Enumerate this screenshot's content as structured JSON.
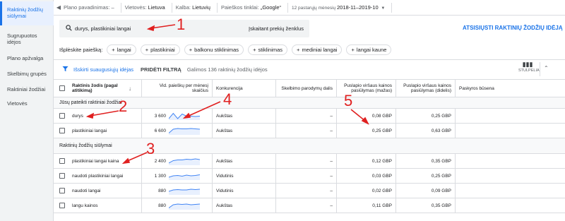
{
  "sidebar": {
    "items": [
      {
        "label": "Raktinių žodžių siūlymai",
        "active": true
      },
      {
        "label": "Sugrupuotos idėjos"
      },
      {
        "label": "Plano apžvalga"
      },
      {
        "label": "Skelbimų grupės"
      },
      {
        "label": "Raktiniai žodžiai"
      },
      {
        "label": "Vietovės"
      }
    ]
  },
  "topbar": {
    "plan_name": "Plano pavadinimas: –",
    "location_label": "Vietovės:",
    "location_value": "Lietuva",
    "language_label": "Kalba:",
    "language_value": "Lietuvių",
    "network_label": "Paieškos tinklai:",
    "network_value": "„Google“",
    "period_label": "12 pastarųjų mėnesių",
    "period_value": "2018-11–2019-10"
  },
  "search": {
    "value": "durys, plastikiniai langai",
    "include_label": "Įskaitant prekių ženklus"
  },
  "download_label": "ATSISIŲSTI RAKTINIŲ ŽODŽIŲ IDĖJĄ",
  "expand": {
    "label": "Išplėskite paiešką:",
    "chips": [
      "langai",
      "plastikiniai",
      "balkonu stiklinimas",
      "stiklinimas",
      "mediniai langai",
      "langai kaune"
    ]
  },
  "filters": {
    "exclude_label": "Išskirti suaugusiųjų idėjas",
    "add_filter": "PRIDĖTI FILTRĄ",
    "count_text": "Galimos 136 raktinių žodžių idėjos",
    "columns_label": "STULPELIAI"
  },
  "table": {
    "headers": {
      "keyword": "Raktinis žodis (pagal atitikimą)",
      "volume": "Vid. paieškų per mėnesį skaičius",
      "competition": "Konkurencija",
      "share": "Skelbimo parodymų dalis",
      "bid_low": "Puslapio viršaus kainos pasiūlymas (mažas)",
      "bid_high": "Puslapio viršaus kainos pasiūlymas (didelis)",
      "account": "Paskyros būsena"
    },
    "group1_label": "Jūsų pateikti raktiniai žodžiai",
    "group2_label": "Raktinių žodžių siūlymai",
    "group1_rows": [
      {
        "keyword": "durys",
        "volume": "3 600",
        "competition": "Aukštas",
        "share": "–",
        "low": "0,08 GBP",
        "high": "0,25 GBP",
        "trend": [
          0.9,
          0.15,
          0.9,
          0.25,
          0.55,
          0.55,
          0.6,
          0.55
        ]
      },
      {
        "keyword": "plastikiniai langai",
        "volume": "6 600",
        "competition": "Aukštas",
        "share": "–",
        "low": "0,25 GBP",
        "high": "0,63 GBP",
        "trend": [
          0.85,
          0.3,
          0.2,
          0.25,
          0.25,
          0.2,
          0.25,
          0.3
        ]
      }
    ],
    "group2_rows": [
      {
        "keyword": "plastikiniai langai kaina",
        "volume": "2 400",
        "competition": "Aukštas",
        "share": "–",
        "low": "0,12 GBP",
        "high": "0,35 GBP",
        "trend": [
          0.8,
          0.45,
          0.35,
          0.35,
          0.25,
          0.3,
          0.2,
          0.3
        ]
      },
      {
        "keyword": "naudoti plastikiniai langai",
        "volume": "1 300",
        "competition": "Vidutinis",
        "share": "–",
        "low": "0,03 GBP",
        "high": "0,25 GBP",
        "trend": [
          0.7,
          0.5,
          0.45,
          0.55,
          0.4,
          0.5,
          0.45,
          0.35
        ]
      },
      {
        "keyword": "naudoti langai",
        "volume": "880",
        "competition": "Vidutinis",
        "share": "–",
        "low": "0,02 GBP",
        "high": "0,09 GBP",
        "trend": [
          0.6,
          0.4,
          0.35,
          0.4,
          0.4,
          0.3,
          0.35,
          0.3
        ]
      },
      {
        "keyword": "langu kainos",
        "volume": "880",
        "competition": "Aukštas",
        "share": "–",
        "low": "0,11 GBP",
        "high": "0,35 GBP",
        "trend": [
          0.85,
          0.4,
          0.3,
          0.35,
          0.3,
          0.4,
          0.35,
          0.3
        ]
      }
    ]
  },
  "annotations": [
    "1",
    "2",
    "3",
    "4",
    "5"
  ],
  "colors": {
    "accent": "#1a73e8",
    "annotation": "#e02020",
    "spark": "#4285f4"
  }
}
